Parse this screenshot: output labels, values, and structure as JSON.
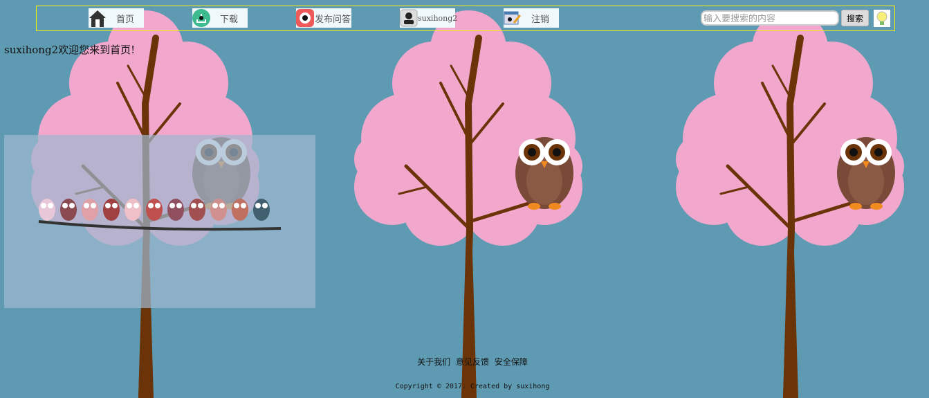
{
  "nav": {
    "items": [
      {
        "label": "首页",
        "icon": "home-icon"
      },
      {
        "label": "下载",
        "icon": "download-icon"
      },
      {
        "label": "发布问答",
        "icon": "qa-icon"
      },
      {
        "label": "suxihong2",
        "icon": "user-icon"
      },
      {
        "label": "注销",
        "icon": "logout-icon"
      }
    ],
    "search_placeholder": "输入要搜索的内容",
    "search_value": "",
    "search_button": "搜索",
    "bulb_icon": "lightbulb-icon"
  },
  "welcome": "suxihong2欢迎您来到首页!",
  "footer": {
    "links": [
      "关于我们",
      "意见反馈",
      "安全保障"
    ],
    "copyright": "Copyright © 2017. Created by suxihong"
  },
  "colors": {
    "background": "#5e9bb3",
    "canopy": "#f2a7cc",
    "trunk": "#6b3408",
    "nav_border": "#f5f000"
  }
}
